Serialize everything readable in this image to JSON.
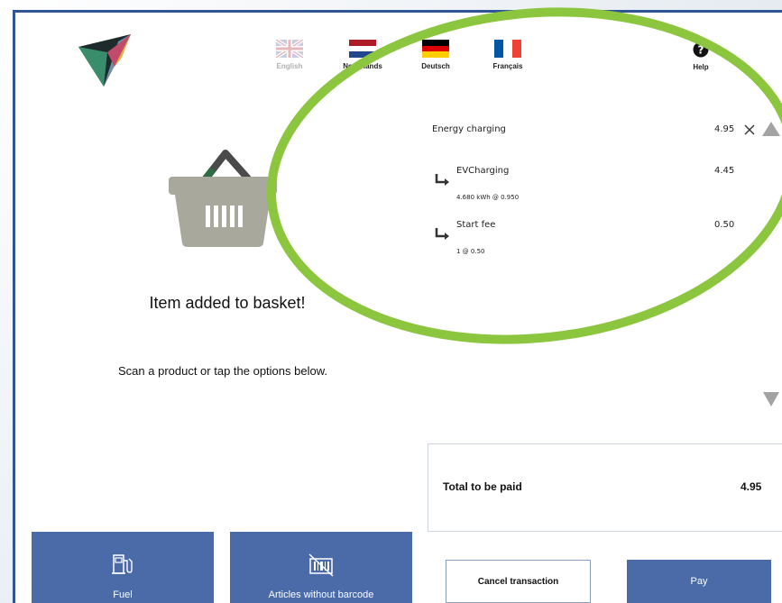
{
  "header": {
    "languages": [
      {
        "label": "English",
        "active": false
      },
      {
        "label": "Nederlands",
        "active": true
      },
      {
        "label": "Deutsch",
        "active": true
      },
      {
        "label": "Français",
        "active": true
      }
    ],
    "help_label": "Help"
  },
  "main": {
    "added_message": "Item added to basket!",
    "scan_message": "Scan a product or tap the options below."
  },
  "basket": {
    "item": {
      "name": "Energy charging",
      "price": "4.95"
    },
    "sub_items": [
      {
        "name": "EVCharging",
        "price": "4.45",
        "detail": "4.680 kWh @ 0.950"
      },
      {
        "name": "Start fee",
        "price": "0.50",
        "detail": "1 @ 0.50"
      }
    ]
  },
  "total": {
    "label": "Total to be paid",
    "value": "4.95"
  },
  "bottom": {
    "fuel_label": "Fuel",
    "articles_label": "Articles without barcode",
    "cancel_label": "Cancel transaction",
    "pay_label": "Pay"
  },
  "colors": {
    "accent": "#4a6aa8",
    "frame": "#2f5597",
    "highlight": "#8cc63f",
    "basket": "#a8a89c"
  }
}
